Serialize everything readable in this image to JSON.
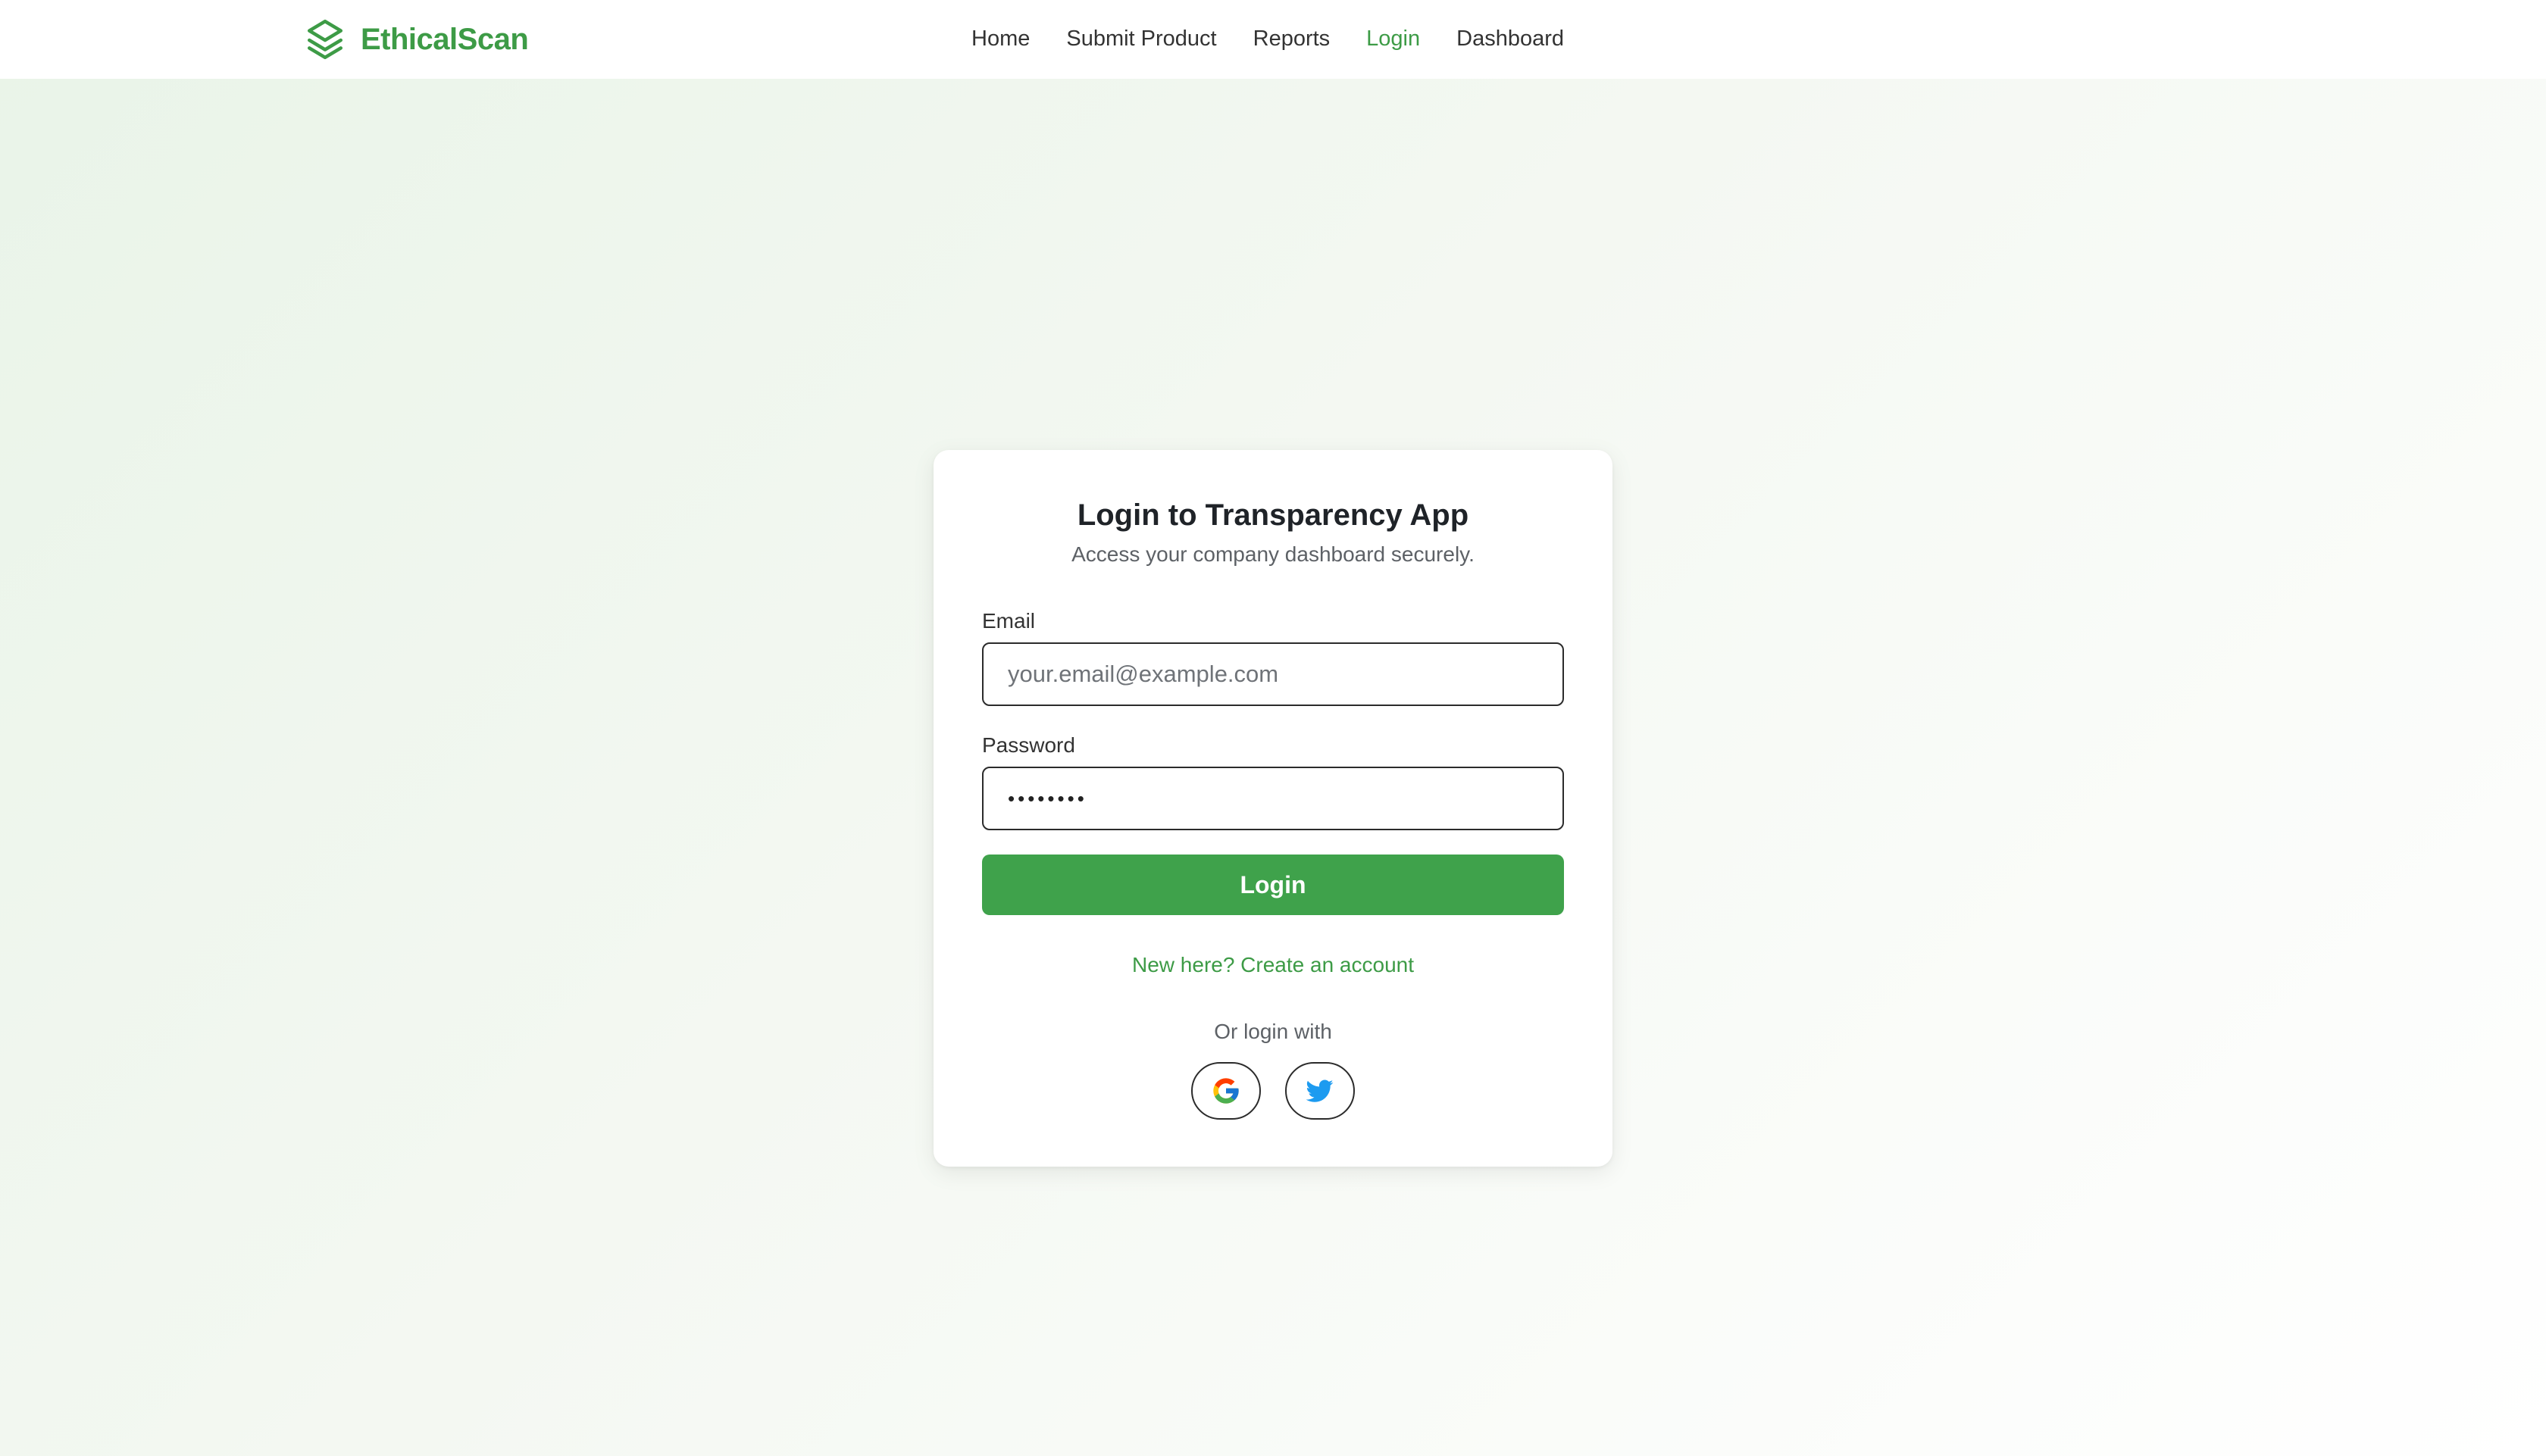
{
  "header": {
    "brand_name": "EthicalScan",
    "nav": [
      {
        "label": "Home",
        "active": false
      },
      {
        "label": "Submit Product",
        "active": false
      },
      {
        "label": "Reports",
        "active": false
      },
      {
        "label": "Login",
        "active": true
      },
      {
        "label": "Dashboard",
        "active": false
      }
    ]
  },
  "login_card": {
    "title": "Login to Transparency App",
    "subtitle": "Access your company dashboard securely.",
    "email": {
      "label": "Email",
      "placeholder": "your.email@example.com",
      "value": ""
    },
    "password": {
      "label": "Password",
      "value": "••••••••"
    },
    "submit_label": "Login",
    "signup_link": "New here? Create an account",
    "social_prompt": "Or login with",
    "social_providers": [
      "google-icon",
      "twitter-icon"
    ]
  },
  "colors": {
    "brand": "#3d9b46",
    "button": "#3fa24b",
    "twitter": "#1d9bf0"
  }
}
